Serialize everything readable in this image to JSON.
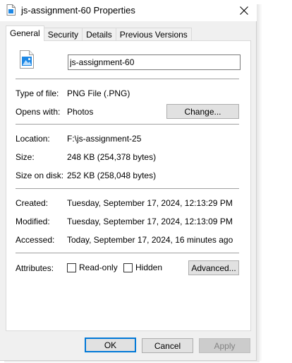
{
  "window": {
    "title": "js-assignment-60 Properties",
    "close_glyph": "✕"
  },
  "tabs": [
    {
      "label": "General",
      "active": true
    },
    {
      "label": "Security",
      "active": false
    },
    {
      "label": "Details",
      "active": false
    },
    {
      "label": "Previous Versions",
      "active": false
    }
  ],
  "general": {
    "file_name": "js-assignment-60",
    "file_icon": "png-image-file-icon",
    "type_label": "Type of file:",
    "type_value": "PNG File (.PNG)",
    "opens_label": "Opens with:",
    "opens_value": "Photos",
    "change_button": "Change...",
    "location_label": "Location:",
    "location_value": "F:\\js-assignment-25",
    "size_label": "Size:",
    "size_value": "248 KB (254,378 bytes)",
    "size_on_disk_label": "Size on disk:",
    "size_on_disk_value": "252 KB (258,048 bytes)",
    "created_label": "Created:",
    "created_value": "Tuesday, September 17, 2024, 12:13:29 PM",
    "modified_label": "Modified:",
    "modified_value": "Tuesday, September 17, 2024, 12:13:09 PM",
    "accessed_label": "Accessed:",
    "accessed_value": "Today, September 17, 2024, 16 minutes ago",
    "attributes_label": "Attributes:",
    "readonly_label": "Read-only",
    "readonly_checked": false,
    "hidden_label": "Hidden",
    "hidden_checked": false,
    "advanced_button": "Advanced..."
  },
  "footer": {
    "ok": "OK",
    "cancel": "Cancel",
    "apply": "Apply"
  },
  "colors": {
    "accent": "#0078d7",
    "dialog_bg": "#f0f0f0",
    "panel_bg": "#ffffff"
  }
}
